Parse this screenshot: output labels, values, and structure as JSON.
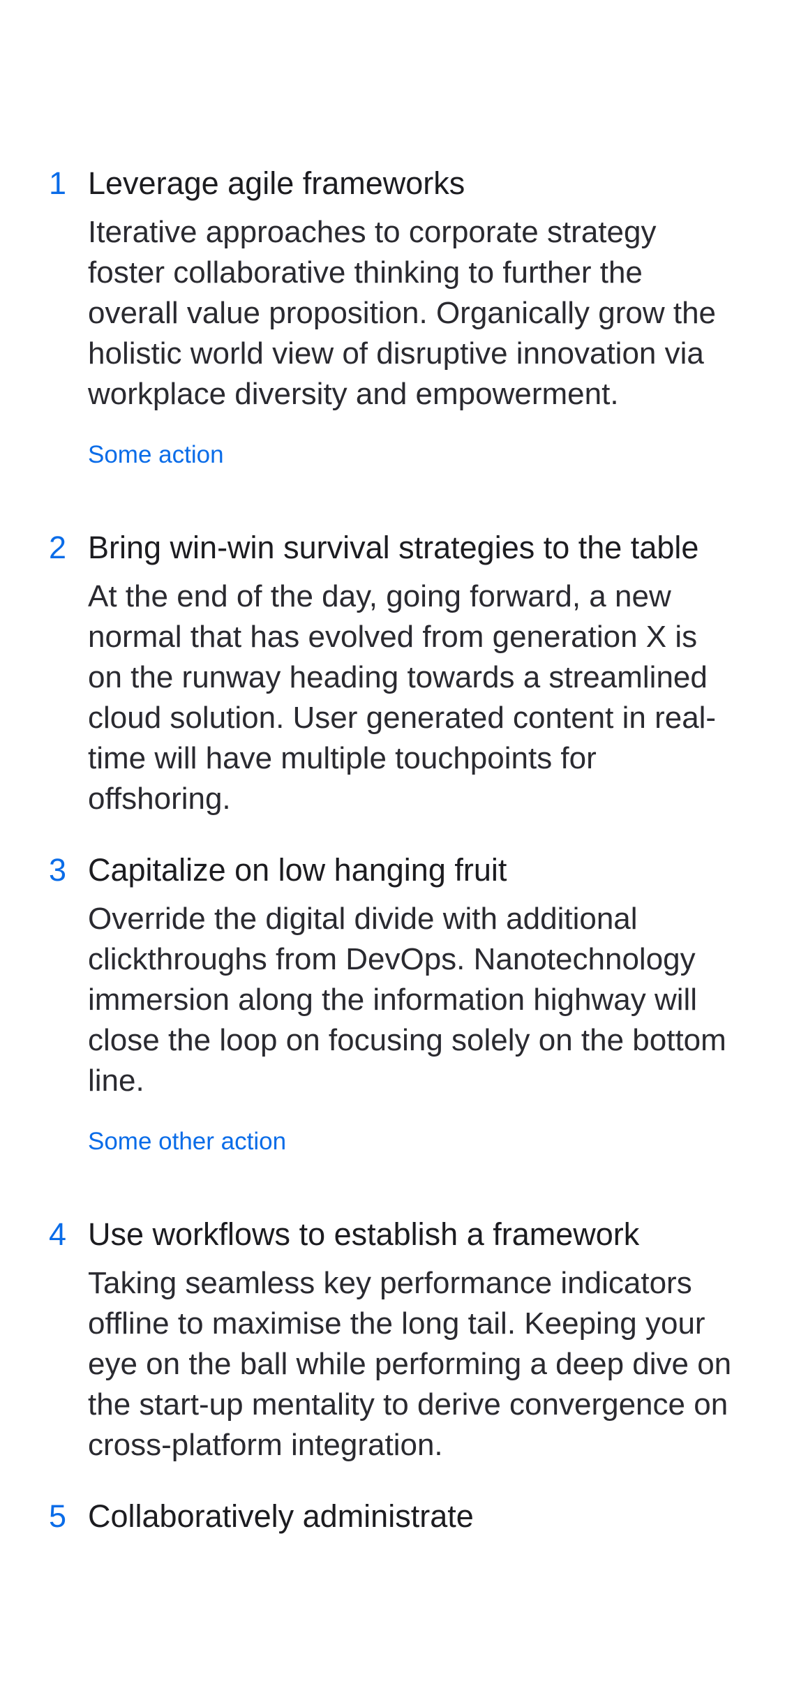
{
  "items": [
    {
      "number": "1",
      "title": "Leverage agile frameworks",
      "body": "Iterative approaches to corporate strategy foster collaborative thinking to further the overall value proposition. Organically grow the holistic world view of disruptive innovation via workplace diversity and empowerment.",
      "action": "Some action"
    },
    {
      "number": "2",
      "title": "Bring win-win survival strategies to the table",
      "body": "At the end of the day, going forward, a new normal that has evolved from generation X is on the runway heading towards a streamlined cloud solution. User generated content in real-time will have multiple touchpoints for offshoring."
    },
    {
      "number": "3",
      "title": "Capitalize on low hanging fruit",
      "body": "Override the digital divide with additional clickthroughs from DevOps. Nanotechnology immersion along the information highway will close the loop on focusing solely on the bottom line.",
      "action": "Some other action"
    },
    {
      "number": "4",
      "title": "Use workflows to establish a framework",
      "body": "Taking seamless key performance indicators offline to maximise the long tail. Keeping your eye on the ball while performing a deep dive on the start-up mentality to derive convergence on cross-platform integration."
    },
    {
      "number": "5",
      "title": "Collaboratively administrate"
    }
  ],
  "colors": {
    "accent": "#0a6ce8",
    "text": "#1f1f24",
    "background": "#ffffff"
  }
}
